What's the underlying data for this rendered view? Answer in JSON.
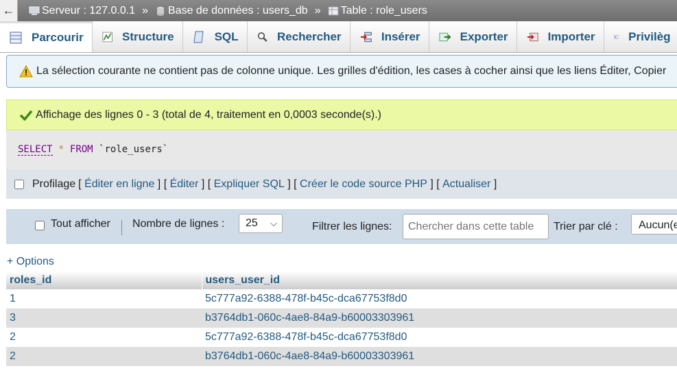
{
  "breadcrumb": {
    "back": "←",
    "server": "Serveur : 127.0.0.1",
    "database": "Base de données : users_db",
    "table": "Table : role_users",
    "separator": "»"
  },
  "tabs": [
    {
      "label": "Parcourir",
      "icon": "browse-icon"
    },
    {
      "label": "Structure",
      "icon": "structure-icon"
    },
    {
      "label": "SQL",
      "icon": "sql-icon"
    },
    {
      "label": "Rechercher",
      "icon": "search-icon"
    },
    {
      "label": "Insérer",
      "icon": "insert-icon"
    },
    {
      "label": "Exporter",
      "icon": "export-icon"
    },
    {
      "label": "Importer",
      "icon": "import-icon"
    },
    {
      "label": "Privilèg",
      "icon": "privileges-icon"
    }
  ],
  "warning": {
    "text": "La sélection courante ne contient pas de colonne unique. Les grilles d'édition, les cases à cocher ainsi que les liens Éditer, Copier"
  },
  "success": {
    "text": "Affichage des lignes 0 - 3 (total de 4, traitement en 0,0003 seconde(s).)"
  },
  "sql": {
    "select": "SELECT",
    "star": "*",
    "from": "FROM",
    "table": "`role_users`"
  },
  "profiling": {
    "label": "Profilage",
    "links": [
      "Éditer en ligne",
      "Éditer",
      "Expliquer SQL",
      "Créer le code source PHP",
      "Actualiser"
    ]
  },
  "nav": {
    "show_all": "Tout afficher",
    "rows_label": "Nombre de lignes :",
    "rows_value": "25",
    "filter_label": "Filtrer les lignes:",
    "filter_placeholder": "Chercher dans cette table",
    "sort_label": "Trier par clé :",
    "sort_value": "Aucun(e)"
  },
  "options_link": "+ Options",
  "table": {
    "columns": [
      "roles_id",
      "users_user_id"
    ],
    "rows": [
      [
        "1",
        "5c777a92-6388-478f-b45c-dca67753f8d0"
      ],
      [
        "3",
        "b3764db1-060c-4ae8-84a9-b60003303961"
      ],
      [
        "2",
        "5c777a92-6388-478f-b45c-dca67753f8d0"
      ],
      [
        "2",
        "b3764db1-060c-4ae8-84a9-b60003303961"
      ]
    ]
  }
}
